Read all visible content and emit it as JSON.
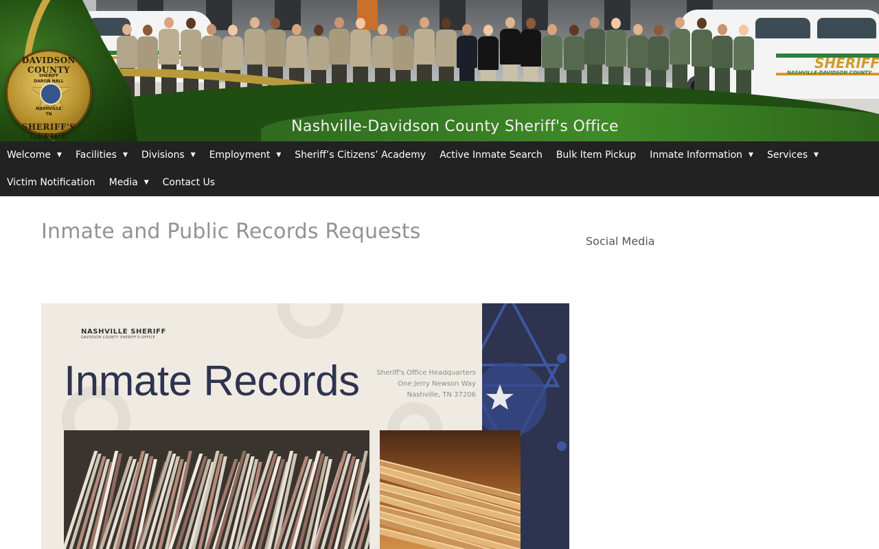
{
  "header": {
    "site_title": "Nashville-Davidson County Sheriff's Office",
    "badge": {
      "top_text": "DAVIDSON COUNTY",
      "bottom_text": "SHERIFF'S OFFICE",
      "line1": "SHERIFF",
      "line2": "DARON HALL",
      "line3": "NASHVILLE",
      "line4": "TN"
    },
    "vehicle_text": "SHERIFF",
    "vehicle_subtext": "NASHVILLE-DAVIDSON COUNTY"
  },
  "nav": {
    "items": [
      {
        "label": "Welcome",
        "has_dropdown": true
      },
      {
        "label": "Facilities",
        "has_dropdown": true
      },
      {
        "label": "Divisions",
        "has_dropdown": true
      },
      {
        "label": "Employment",
        "has_dropdown": true
      },
      {
        "label": "Sheriff’s Citizens’ Academy",
        "has_dropdown": false
      },
      {
        "label": "Active Inmate Search",
        "has_dropdown": false
      },
      {
        "label": "Bulk Item Pickup",
        "has_dropdown": false
      },
      {
        "label": "Inmate Information",
        "has_dropdown": true
      },
      {
        "label": "Services",
        "has_dropdown": true
      },
      {
        "label": "Victim Notification",
        "has_dropdown": false
      },
      {
        "label": "Media",
        "has_dropdown": true
      },
      {
        "label": "Contact Us",
        "has_dropdown": false
      }
    ],
    "caret_glyph": "▼"
  },
  "main": {
    "page_title": "Inmate and Public Records Requests",
    "hero": {
      "brand": "NASHVILLE SHERIFF",
      "brand_sub": "DAVIDSON COUNTY SHERIFF'S OFFICE",
      "title": "Inmate Records",
      "address": [
        "Sheriff's Office Headquarters",
        "One Jerry Newson Way",
        "Nashville, TN 37206"
      ]
    }
  },
  "sidebar": {
    "title": "Social Media"
  },
  "colors": {
    "nav_bg": "#222222",
    "banner_green": "#1f4d12",
    "gold": "#b89a3c",
    "navy": "#2e3350",
    "cream": "#efebe2",
    "title_gray": "#929292"
  }
}
